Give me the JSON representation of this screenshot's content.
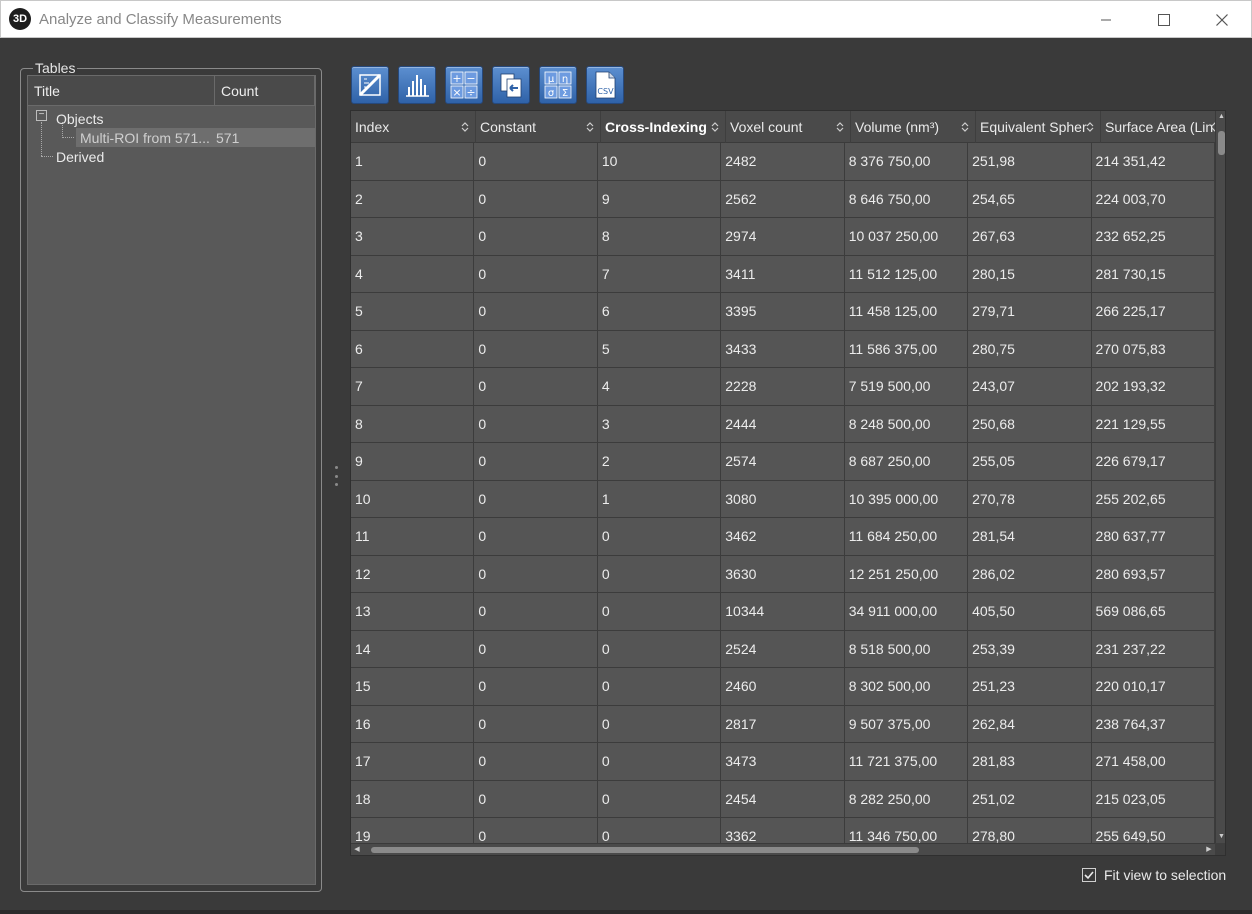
{
  "window": {
    "app_icon": "3D",
    "title": "Analyze and Classify Measurements"
  },
  "tables_panel": {
    "group_label": "Tables",
    "columns": {
      "title": "Title",
      "count": "Count"
    },
    "tree": {
      "objects_label": "Objects",
      "child_label": "Multi-ROI from 571...",
      "child_count": "571",
      "derived_label": "Derived"
    }
  },
  "toolbar": {
    "icons": [
      "ruler-icon",
      "histogram-icon",
      "arithmetic-icon",
      "export-icon",
      "statistics-icon",
      "csv-icon"
    ],
    "csv_label": "CSV",
    "stats_symbols": [
      "μ",
      "η",
      "σ",
      "Σ"
    ],
    "arith_symbols": [
      "+",
      "−",
      "×",
      "÷"
    ]
  },
  "grid": {
    "columns": [
      "Index",
      "Constant",
      "Cross-Indexing",
      "Voxel count",
      "Volume (nm³)",
      "Equivalent Spher",
      "Surface Area (Lin"
    ],
    "bold_column": 2,
    "rows": [
      [
        "1",
        "0",
        "10",
        "2482",
        "8 376 750,00",
        "251,98",
        "214 351,42"
      ],
      [
        "2",
        "0",
        "9",
        "2562",
        "8 646 750,00",
        "254,65",
        "224 003,70"
      ],
      [
        "3",
        "0",
        "8",
        "2974",
        "10 037 250,00",
        "267,63",
        "232 652,25"
      ],
      [
        "4",
        "0",
        "7",
        "3411",
        "11 512 125,00",
        "280,15",
        "281 730,15"
      ],
      [
        "5",
        "0",
        "6",
        "3395",
        "11 458 125,00",
        "279,71",
        "266 225,17"
      ],
      [
        "6",
        "0",
        "5",
        "3433",
        "11 586 375,00",
        "280,75",
        "270 075,83"
      ],
      [
        "7",
        "0",
        "4",
        "2228",
        "7 519 500,00",
        "243,07",
        "202 193,32"
      ],
      [
        "8",
        "0",
        "3",
        "2444",
        "8 248 500,00",
        "250,68",
        "221 129,55"
      ],
      [
        "9",
        "0",
        "2",
        "2574",
        "8 687 250,00",
        "255,05",
        "226 679,17"
      ],
      [
        "10",
        "0",
        "1",
        "3080",
        "10 395 000,00",
        "270,78",
        "255 202,65"
      ],
      [
        "11",
        "0",
        "0",
        "3462",
        "11 684 250,00",
        "281,54",
        "280 637,77"
      ],
      [
        "12",
        "0",
        "0",
        "3630",
        "12 251 250,00",
        "286,02",
        "280 693,57"
      ],
      [
        "13",
        "0",
        "0",
        "10344",
        "34 911 000,00",
        "405,50",
        "569 086,65"
      ],
      [
        "14",
        "0",
        "0",
        "2524",
        "8 518 500,00",
        "253,39",
        "231 237,22"
      ],
      [
        "15",
        "0",
        "0",
        "2460",
        "8 302 500,00",
        "251,23",
        "220 010,17"
      ],
      [
        "16",
        "0",
        "0",
        "2817",
        "9 507 375,00",
        "262,84",
        "238 764,37"
      ],
      [
        "17",
        "0",
        "0",
        "3473",
        "11 721 375,00",
        "281,83",
        "271 458,00"
      ],
      [
        "18",
        "0",
        "0",
        "2454",
        "8 282 250,00",
        "251,02",
        "215 023,05"
      ],
      [
        "19",
        "0",
        "0",
        "3362",
        "11 346 750,00",
        "278,80",
        "255 649,50"
      ]
    ]
  },
  "fit_view": {
    "label": "Fit view to selection",
    "checked": true
  },
  "colors": {
    "background": "#3a3a3a",
    "grid_cell": "#555555",
    "toolbar_button": "#3f74bd"
  }
}
